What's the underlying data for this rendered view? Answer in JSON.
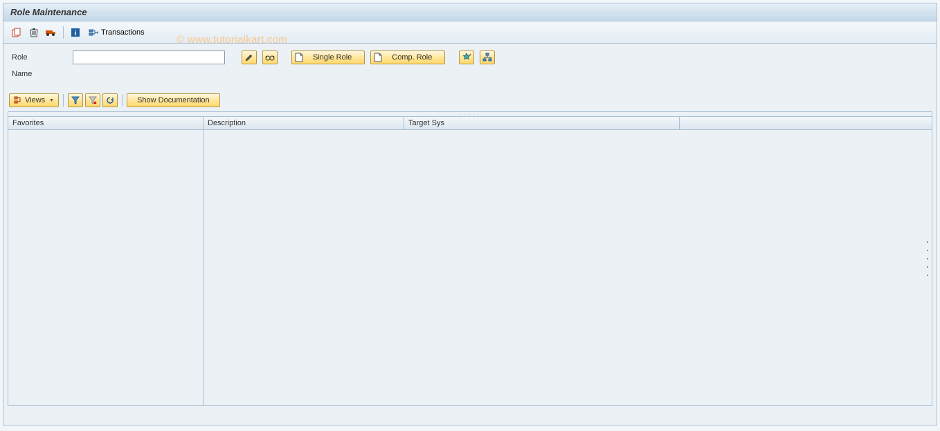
{
  "title": "Role Maintenance",
  "toolbar": {
    "transactions_label": "Transactions"
  },
  "form": {
    "role_label": "Role",
    "role_value": "",
    "name_label": "Name",
    "single_role_label": "Single Role",
    "comp_role_label": "Comp. Role"
  },
  "lower_toolbar": {
    "views_label": "Views",
    "show_doc_label": "Show Documentation"
  },
  "table": {
    "columns": [
      "Favorites",
      "Description",
      "Target Sys",
      ""
    ]
  },
  "watermark": "© www.tutorialkart.com"
}
